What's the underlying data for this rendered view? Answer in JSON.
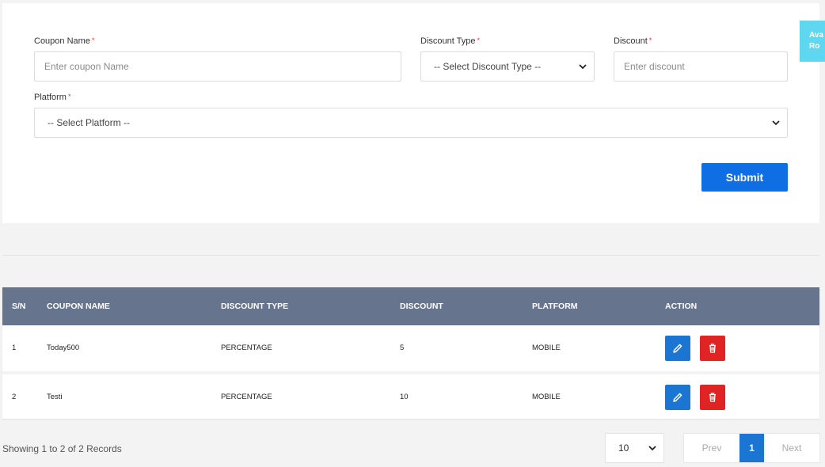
{
  "form": {
    "coupon_name": {
      "label": "Coupon Name",
      "required": "*",
      "placeholder": "Enter coupon Name",
      "value": ""
    },
    "discount_type": {
      "label": "Discount Type",
      "required": "*",
      "selected": "-- Select Discount Type --"
    },
    "discount": {
      "label": "Discount",
      "required": "*",
      "placeholder": "Enter discount",
      "value": ""
    },
    "platform": {
      "label": "Platform",
      "required": "*",
      "selected": "-- Select Platform --"
    },
    "submit_label": "Submit"
  },
  "side_tab": {
    "line1": "Ava",
    "line2": "Ro"
  },
  "table": {
    "headers": {
      "sn": "S/N",
      "name": "COUPON NAME",
      "type": "DISCOUNT TYPE",
      "discount": "DISCOUNT",
      "platform": "PLATFORM",
      "action": "ACTION"
    },
    "rows": [
      {
        "sn": "1",
        "name": "Today500",
        "type": "PERCENTAGE",
        "discount": "5",
        "platform": "MOBILE"
      },
      {
        "sn": "2",
        "name": "Testi",
        "type": "PERCENTAGE",
        "discount": "10",
        "platform": "MOBILE"
      }
    ]
  },
  "footer": {
    "records_text": "Showing 1 to 2 of 2 Records",
    "page_size": "10",
    "prev_label": "Prev",
    "current_page": "1",
    "next_label": "Next"
  },
  "colors": {
    "primary": "#0f6ee4",
    "header_bg": "#66758d",
    "edit": "#1b76d3",
    "delete": "#e02424",
    "side_tab": "#5ed7f0"
  }
}
